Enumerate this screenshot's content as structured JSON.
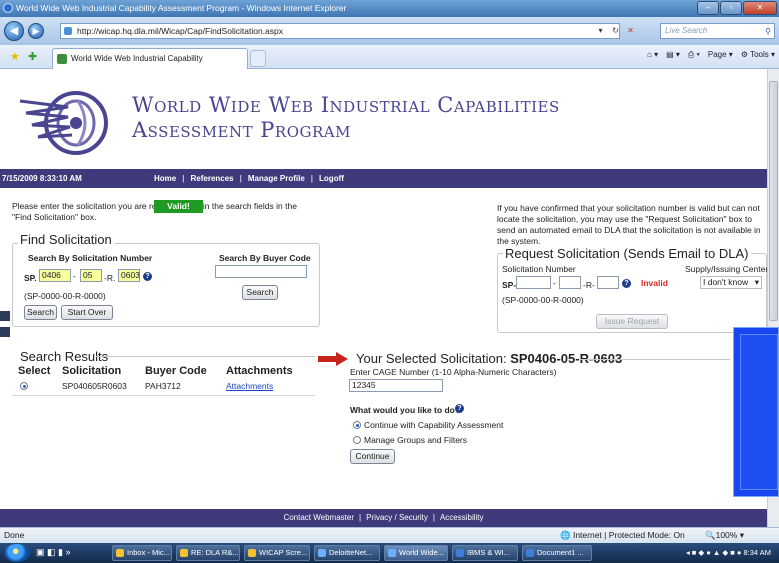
{
  "window": {
    "title": "World Wide Web Industrial Capability Assessment Program - Windows Internet Explorer",
    "url": "http://wicap.hq.dla.mil/Wicap/Cap/FindSolicitation.aspx",
    "live_search_placeholder": "Live Search",
    "tab_title": "World Wide Web Industrial Capability Assessmen...",
    "cmd_page": "Page",
    "cmd_tools": "Tools"
  },
  "site": {
    "title_line1": "World Wide Web Industrial Capabilities",
    "title_line2": "Assessment Program"
  },
  "nav": {
    "datetime": "7/15/2009 8:33:10 AM",
    "links": [
      "Home",
      "References",
      "Manage Profile",
      "Logoff"
    ]
  },
  "intro": {
    "left": "Please enter the solicitation you are responding to in the search fields in the \"Find Solicitation\" box.",
    "right": "If you have confirmed that your solicitation number is valid but can not locate the solicitation, you may use the \"Request Solicitation\" box to send an automated email to DLA that the solicitation is not available in the system."
  },
  "find": {
    "title": "Find Solicitation",
    "by_number_label": "Search By Solicitation Number",
    "prefix": "SP.",
    "part1": "0406",
    "dash1": "-",
    "part2": "05",
    "dash2": "-R.",
    "part3": "0603",
    "valid_label": "Valid!",
    "format_hint": "(SP-0000-00-R-0000)",
    "search_button": "Search",
    "start_over_button": "Start Over",
    "by_buyer_label": "Search By Buyer Code",
    "buyer_value": "",
    "buyer_search_button": "Search"
  },
  "request": {
    "title": "Request Solicitation (Sends Email to DLA)",
    "number_label": "Solicitation Number",
    "supply_label": "Supply/Issuing Center",
    "prefix": "SP-",
    "dash1": "-",
    "dash2": "-R-",
    "invalid_label": "Invalid",
    "format_hint": "(SP-0000-00-R-0000)",
    "supply_value": "I don't know",
    "issue_button": "Issue Request"
  },
  "results": {
    "title": "Search Results",
    "headers": [
      "Select",
      "Solicitation",
      "Buyer Code",
      "Attachments"
    ],
    "rows": [
      {
        "solicitation": "SP040605R0603",
        "buyer_code": "PAH3712",
        "attachments": "Attachments"
      }
    ]
  },
  "selected": {
    "heading": "Your Selected Solicitation:",
    "number": "SP0406-05-R-0603",
    "cage_label": "Enter CAGE Number (1-10 Alpha-Numeric Characters)",
    "cage_value": "12345",
    "question": "What would you like to do?",
    "options": [
      "Continue with Capability Assessment",
      "Manage Groups and Filters"
    ],
    "continue_button": "Continue"
  },
  "footer": {
    "links": [
      "Contact Webmaster",
      "Privacy / Security",
      "Accessibility"
    ]
  },
  "status": {
    "left": "Done",
    "zone": "Internet | Protected Mode: On",
    "zoom": "100%"
  },
  "taskbar": {
    "items": [
      "Inbox - Mic...",
      "RE: DLA R&...",
      "WICAP Scre...",
      "DeloitteNet...",
      "World Wide...",
      "IBMS & WI...",
      "Document1 ..."
    ],
    "time": "8:34 AM"
  },
  "colors": {
    "nav_bg": "#3e3a7c",
    "title_text": "#4a4590",
    "valid_bg": "#1f9a23",
    "invalid_text": "#e02a22",
    "highlight_input": "#f6ff9c",
    "overlay_blue": "#1846f0"
  }
}
